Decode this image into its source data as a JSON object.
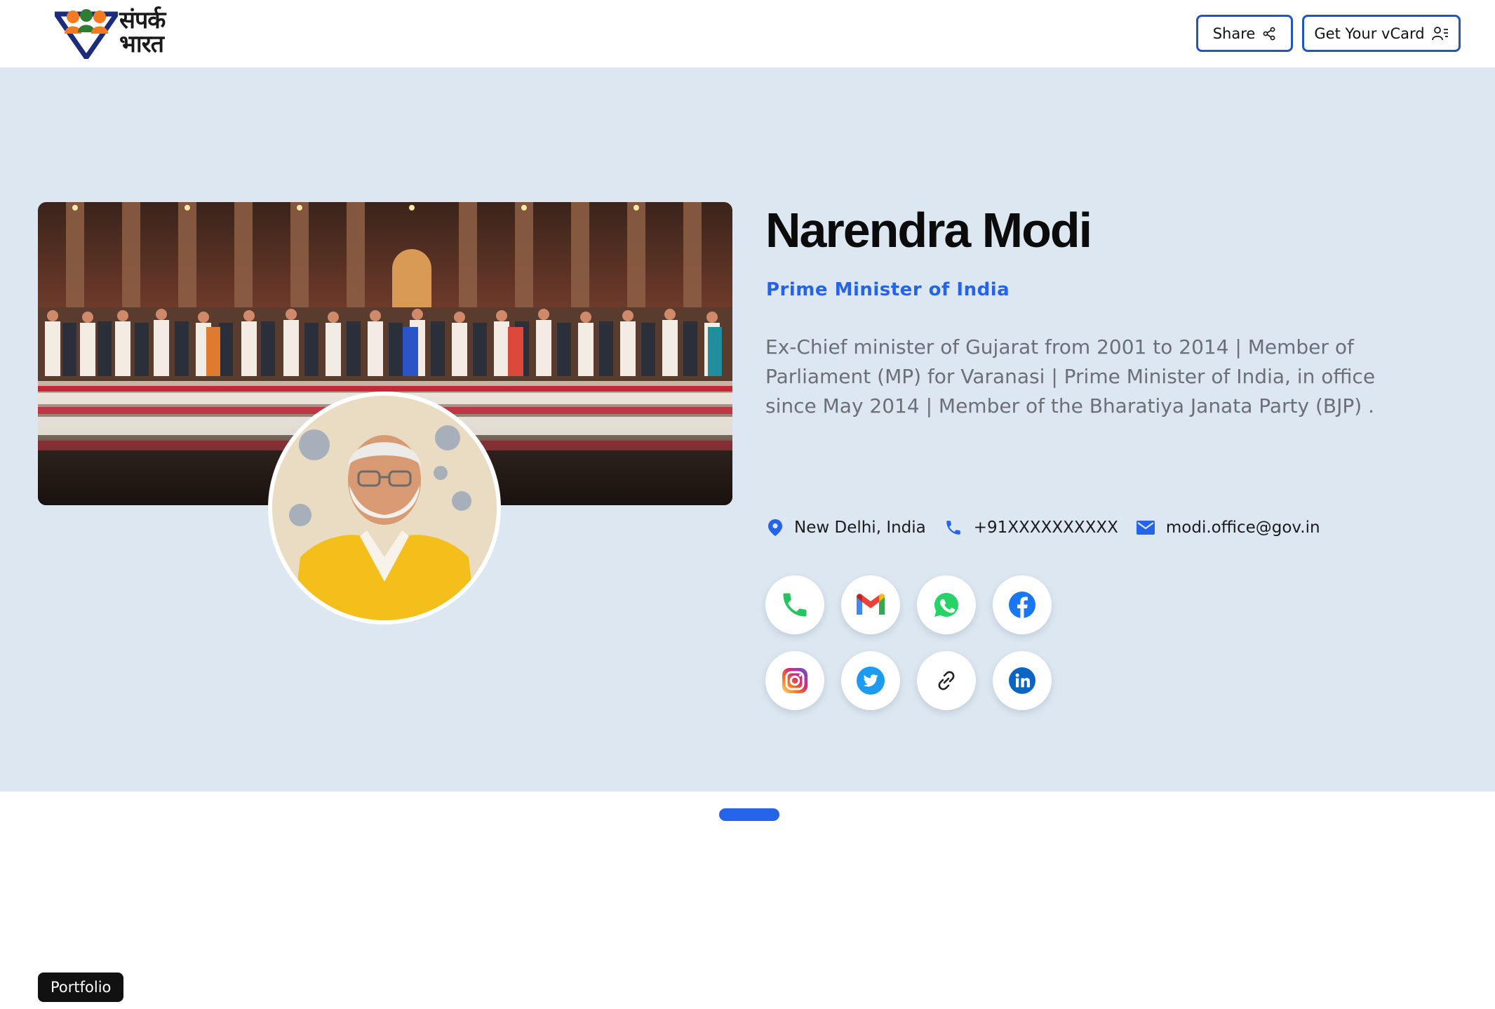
{
  "header": {
    "logo_text_line1": "संपर्क",
    "logo_text_line2": "भारत",
    "share_label": "Share",
    "vcard_label": "Get Your vCard"
  },
  "profile": {
    "name": "Narendra Modi",
    "title": "Prime Minister of India",
    "bio": "Ex-Chief minister of Gujarat from 2001 to 2014 | Member of Parliament (MP) for Varanasi | Prime Minister of India, in office since May 2014 | Member of the Bharatiya Janata Party (BJP) .",
    "location": "New Delhi, India",
    "phone": "+91XXXXXXXXXX",
    "email": "modi.office@gov.in"
  },
  "social": [
    {
      "icon": "phone-icon",
      "color": "#22c55e"
    },
    {
      "icon": "gmail-icon",
      "color": "#ea4335"
    },
    {
      "icon": "whatsapp-icon",
      "color": "#25d366"
    },
    {
      "icon": "facebook-icon",
      "color": "#1877f2"
    },
    {
      "icon": "instagram-icon",
      "color": "#d62976"
    },
    {
      "icon": "twitter-icon",
      "color": "#1d9bf0"
    },
    {
      "icon": "link-icon",
      "color": "#222222"
    },
    {
      "icon": "linkedin-icon",
      "color": "#0a66c2"
    }
  ],
  "footer": {
    "portfolio_label": "Portfolio"
  },
  "colors": {
    "accent": "#2563eb",
    "hero_bg": "#dce7f1",
    "button_border": "#1f55c9"
  }
}
